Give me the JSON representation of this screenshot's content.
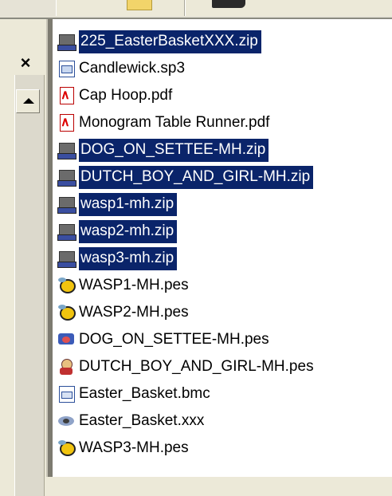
{
  "files": [
    {
      "name": "225_EasterBasketXXX.zip",
      "icon": "zip-archive-icon",
      "selected": true
    },
    {
      "name": "Candlewick.sp3",
      "icon": "sp3-file-icon",
      "selected": false
    },
    {
      "name": "Cap Hoop.pdf",
      "icon": "pdf-file-icon",
      "selected": false
    },
    {
      "name": "Monogram Table Runner.pdf",
      "icon": "pdf-file-icon",
      "selected": false
    },
    {
      "name": "DOG_ON_SETTEE-MH.zip",
      "icon": "zip-archive-icon",
      "selected": true
    },
    {
      "name": "DUTCH_BOY_AND_GIRL-MH.zip",
      "icon": "zip-archive-icon",
      "selected": true
    },
    {
      "name": "wasp1-mh.zip",
      "icon": "zip-archive-icon",
      "selected": true
    },
    {
      "name": "wasp2-mh.zip",
      "icon": "zip-archive-icon",
      "selected": true
    },
    {
      "name": "wasp3-mh.zip",
      "icon": "zip-archive-icon",
      "selected": true
    },
    {
      "name": "WASP1-MH.pes",
      "icon": "wasp-embroidery-icon",
      "selected": false
    },
    {
      "name": "WASP2-MH.pes",
      "icon": "wasp-embroidery-icon",
      "selected": false
    },
    {
      "name": "DOG_ON_SETTEE-MH.pes",
      "icon": "dog-embroidery-icon",
      "selected": false
    },
    {
      "name": "DUTCH_BOY_AND_GIRL-MH.pes",
      "icon": "dutch-boy-embroidery-icon",
      "selected": false
    },
    {
      "name": "Easter_Basket.bmc",
      "icon": "bmc-file-icon",
      "selected": false
    },
    {
      "name": "Easter_Basket.xxx",
      "icon": "xxx-embroidery-icon",
      "selected": false
    },
    {
      "name": "WASP3-MH.pes",
      "icon": "wasp-embroidery-icon",
      "selected": false
    }
  ],
  "left_pane": {
    "close_glyph": "×"
  },
  "colors": {
    "selection": "#0a246a",
    "selection_text": "#ffffff",
    "window_bg": "#ece9d8"
  }
}
